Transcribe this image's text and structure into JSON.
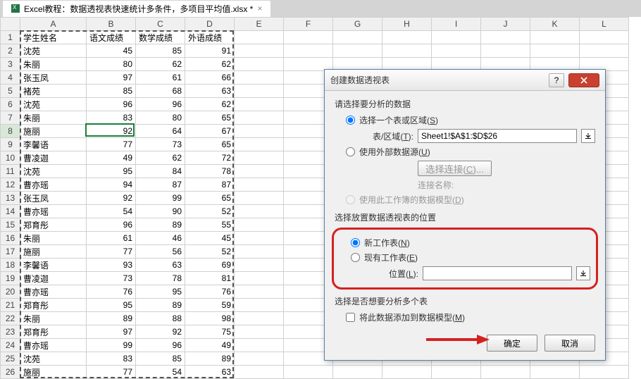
{
  "tab": {
    "filename": "Excel教程：数据透视表快速统计多条件，多项目平均值.xlsx *"
  },
  "columns": [
    "A",
    "B",
    "C",
    "D",
    "E",
    "F",
    "G",
    "H",
    "I",
    "J",
    "K",
    "L"
  ],
  "headers": [
    "学生姓名",
    "语文成绩",
    "数学成绩",
    "外语成绩"
  ],
  "rows": [
    [
      "沈苑",
      45,
      85,
      91
    ],
    [
      "朱丽",
      80,
      62,
      62
    ],
    [
      "张玉凤",
      97,
      61,
      66
    ],
    [
      "褚苑",
      85,
      68,
      63
    ],
    [
      "沈苑",
      96,
      96,
      62
    ],
    [
      "朱丽",
      83,
      80,
      65
    ],
    [
      "施丽",
      92,
      64,
      67
    ],
    [
      "李馨语",
      77,
      73,
      65
    ],
    [
      "曹凌迦",
      49,
      62,
      72
    ],
    [
      "沈苑",
      95,
      84,
      78
    ],
    [
      "曹亦瑶",
      94,
      87,
      87
    ],
    [
      "张玉凤",
      92,
      99,
      65
    ],
    [
      "曹亦瑶",
      54,
      90,
      52
    ],
    [
      "郑育彤",
      96,
      89,
      55
    ],
    [
      "朱丽",
      61,
      46,
      45
    ],
    [
      "施丽",
      77,
      56,
      52
    ],
    [
      "李馨语",
      93,
      63,
      69
    ],
    [
      "曹凌迦",
      73,
      78,
      81
    ],
    [
      "曹亦瑶",
      76,
      95,
      76
    ],
    [
      "郑育彤",
      95,
      89,
      59
    ],
    [
      "朱丽",
      89,
      88,
      98
    ],
    [
      "郑育彤",
      97,
      92,
      75
    ],
    [
      "曹亦瑶",
      99,
      96,
      49
    ],
    [
      "沈苑",
      83,
      85,
      89
    ],
    [
      "施丽",
      77,
      54,
      63
    ]
  ],
  "selected_cell_display": "92",
  "dialog": {
    "title": "创建数据透视表",
    "help": "?",
    "sect1": "请选择要分析的数据",
    "opt_table": "选择一个表或区域",
    "opt_table_key": "S",
    "fld_range": "表/区域",
    "fld_range_key": "T",
    "range_value": "Sheet1!$A$1:$D$26",
    "opt_ext": "使用外部数据源",
    "opt_ext_key": "U",
    "btn_conn": "选择连接",
    "btn_conn_key": "C",
    "conn_name": "连接名称:",
    "opt_model": "使用此工作簿的数据模型",
    "opt_model_key": "D",
    "sect2": "选择放置数据透视表的位置",
    "opt_new": "新工作表",
    "opt_new_key": "N",
    "opt_exist": "现有工作表",
    "opt_exist_key": "E",
    "fld_loc": "位置",
    "fld_loc_key": "L",
    "loc_value": "",
    "sect3": "选择是否想要分析多个表",
    "chk_add": "将此数据添加到数据模型",
    "chk_add_key": "M",
    "ok": "确定",
    "cancel": "取消"
  }
}
